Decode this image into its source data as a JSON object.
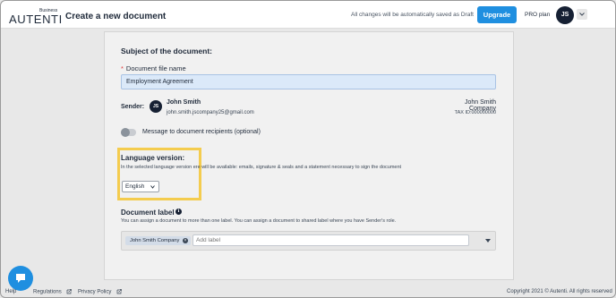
{
  "header": {
    "logo_business": "Business",
    "logo_text": "AUTENTI",
    "title": "Create a new document",
    "autosave_note": "All changes will be automatically saved as Draft",
    "upgrade_label": "Upgrade",
    "plan_label": "PRO plan",
    "avatar_initials": "JS"
  },
  "form": {
    "subject_title": "Subject of the document:",
    "filename_required_marker": "*",
    "filename_label": "Document file name",
    "filename_value": "Employment Agreement",
    "sender_label": "Sender:",
    "sender_initials": "JS",
    "sender_name": "John Smith",
    "sender_email": "john.smith.jscompany25@gmail.com",
    "company_name": "John Smith Company",
    "tax_id": "TAX ID:000000000",
    "message_toggle_label": "Message to document recipients (optional)",
    "language_title": "Language version:",
    "language_desc": "In the selected language version    ere will be available: emails, signature & seals and a statement necessary to sign the document",
    "language_selected": "English",
    "document_label_title": "Document label",
    "document_label_desc": "You can assign a document to more than one label. You can assign a document to shared label where you have Sender's role.",
    "label_chip": "John Smith Company",
    "add_label_placeholder": "Add label"
  },
  "footer": {
    "help": "Help",
    "regulations": "Regulations",
    "privacy": "Privacy Policy",
    "copyright": "Copyright 2021 © Autenti. All rights reserved"
  },
  "colors": {
    "accent": "#1f8fe0",
    "highlight": "#f4cc4e",
    "dark": "#162033"
  }
}
